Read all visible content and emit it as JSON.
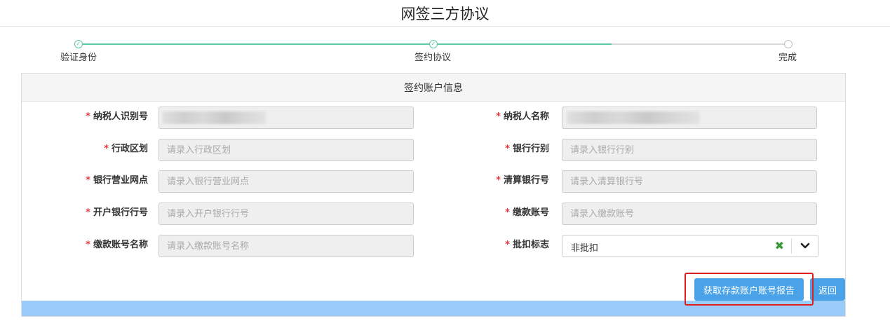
{
  "page": {
    "title": "网签三方协议"
  },
  "stepper": {
    "steps": [
      {
        "label": "验证身份",
        "status": "done"
      },
      {
        "label": "签约协议",
        "status": "current"
      },
      {
        "label": "完成",
        "status": "todo"
      }
    ],
    "done_icon": "check-icon",
    "todo_icon": "circle-icon"
  },
  "panel": {
    "title": "签约账户信息"
  },
  "form": {
    "taxpayer_id": {
      "label": "纳税人识别号",
      "value": ""
    },
    "taxpayer_name": {
      "label": "纳税人名称",
      "value": ""
    },
    "admin_region": {
      "label": "行政区划",
      "placeholder": "请录入行政区划"
    },
    "bank_type": {
      "label": "银行行别",
      "placeholder": "请录入银行行别"
    },
    "bank_branch": {
      "label": "银行营业网点",
      "placeholder": "请录入银行营业网点"
    },
    "clearing_bank_no": {
      "label": "清算银行号",
      "placeholder": "请录入清算银行号"
    },
    "open_bank_no": {
      "label": "开户银行行号",
      "placeholder": "请录入开户银行行号"
    },
    "payment_account": {
      "label": "缴款账号",
      "placeholder": "请录入缴款账号"
    },
    "payment_account_name": {
      "label": "缴款账号名称",
      "placeholder": "请录入缴款账号名称"
    },
    "batch_flag": {
      "label": "批扣标志",
      "value": "非批扣",
      "clear_icon": "close-icon",
      "dropdown_icon": "chevron-down-icon"
    },
    "required_mark": "*"
  },
  "actions": {
    "get_report_label": "获取存款账户账号报告",
    "back_label": "返回"
  },
  "colors": {
    "accent": "#4aa3e8",
    "progress": "#5cc9a7",
    "required": "#e4393c",
    "highlight": "#e02020",
    "footer": "#99ccf8"
  }
}
